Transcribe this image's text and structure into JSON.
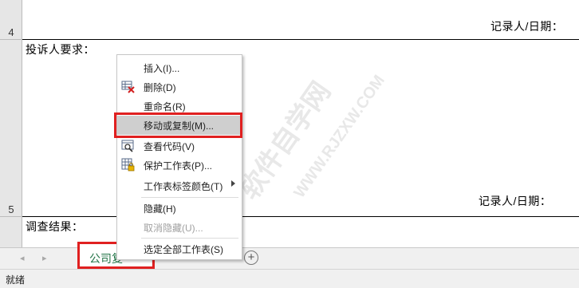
{
  "rows": [
    {
      "number": "4"
    },
    {
      "number": "5"
    }
  ],
  "cells": {
    "recorder_date_1": "记录人/日期：",
    "complainant_request": "投诉人要求：",
    "recorder_date_2": "记录人/日期：",
    "investigation_result": "调查结果："
  },
  "sheet_tabs": {
    "nav_prev": "◂",
    "nav_next": "▸",
    "active_tab": "公司复",
    "add_sheet": "+"
  },
  "status_bar": {
    "text": "就绪"
  },
  "context_menu": {
    "items": [
      {
        "label": "插入(I)...",
        "icon": "none",
        "enabled": true
      },
      {
        "label": "删除(D)",
        "icon": "delete-sheet-icon",
        "enabled": true
      },
      {
        "label": "重命名(R)",
        "icon": "none",
        "enabled": true
      },
      {
        "label": "移动或复制(M)...",
        "icon": "none",
        "enabled": true
      },
      {
        "label": "查看代码(V)",
        "icon": "view-code-icon",
        "enabled": true
      },
      {
        "label": "保护工作表(P)...",
        "icon": "protect-sheet-icon",
        "enabled": true
      },
      {
        "label": "工作表标签颜色(T)",
        "icon": "none",
        "enabled": true,
        "submenu": true
      },
      {
        "label": "隐藏(H)",
        "icon": "none",
        "enabled": true
      },
      {
        "label": "取消隐藏(U)...",
        "icon": "none",
        "enabled": false
      },
      {
        "label": "选定全部工作表(S)",
        "icon": "none",
        "enabled": true
      }
    ],
    "hovered_item": "移动或复制(M)..."
  },
  "watermark": {
    "main": "软件自学网",
    "url": "WWW.RJZXW.COM"
  },
  "colors": {
    "highlight_border": "#e02020",
    "active_tab_text": "#217346",
    "hover_bg": "#cfcfcf"
  }
}
